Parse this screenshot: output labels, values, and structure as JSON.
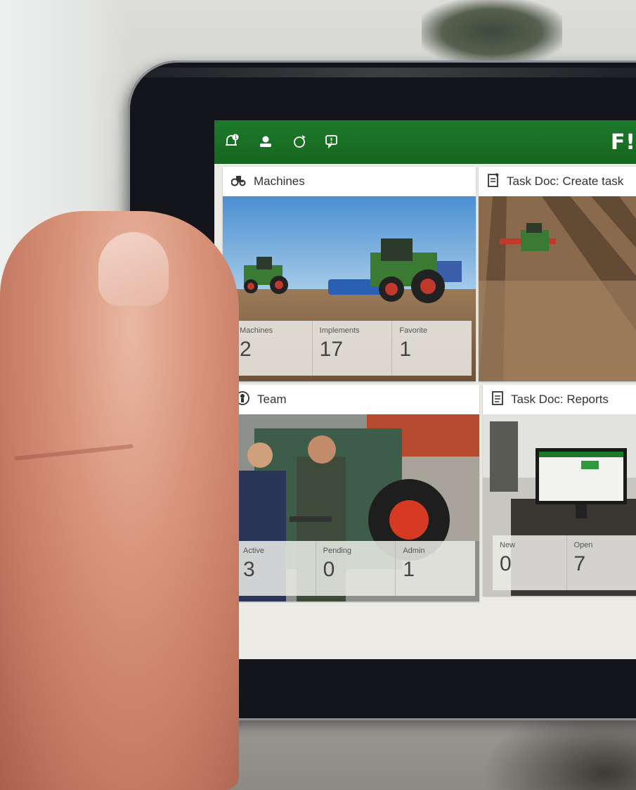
{
  "app": {
    "brand": "F!",
    "accent": "#1d7a2b"
  },
  "topbar": {
    "icons": [
      "notification-icon",
      "profile-icon",
      "sync-icon",
      "feedback-icon"
    ]
  },
  "tiles": {
    "machines": {
      "title": "Machines",
      "icon": "tractor-icon",
      "stats": [
        {
          "label": "Machines",
          "value": "2"
        },
        {
          "label": "Implements",
          "value": "17"
        },
        {
          "label": "Favorite",
          "value": "1"
        }
      ]
    },
    "create_task": {
      "title": "Task Doc: Create task",
      "icon": "document-add-icon"
    },
    "team": {
      "title": "Team",
      "icon": "person-icon",
      "stats": [
        {
          "label": "Active",
          "value": "3"
        },
        {
          "label": "Pending",
          "value": "0"
        },
        {
          "label": "Admin",
          "value": "1"
        }
      ]
    },
    "reports": {
      "title": "Task Doc: Reports",
      "icon": "document-icon",
      "stats": [
        {
          "label": "New",
          "value": "0"
        },
        {
          "label": "Open",
          "value": "7"
        }
      ]
    }
  }
}
